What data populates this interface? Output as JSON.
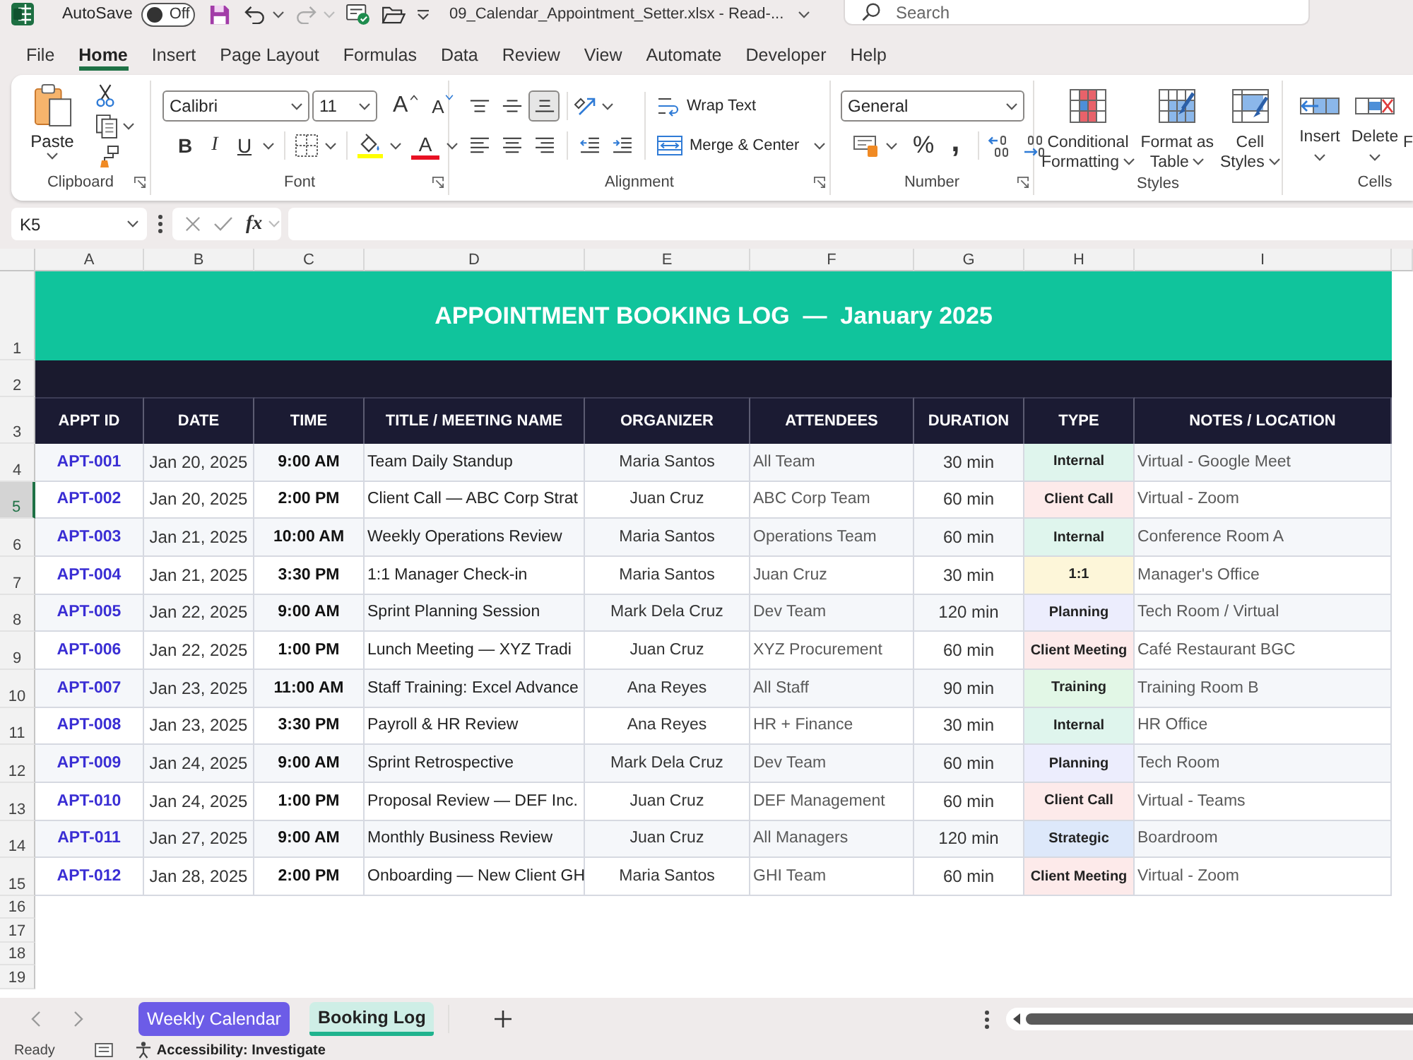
{
  "title_bar": {
    "autosave_label": "AutoSave",
    "autosave": {
      "on": false,
      "label": "Off"
    },
    "filename": "09_Calendar_Appointment_Setter.xlsx - Read-...",
    "search": {
      "placeholder": "Search"
    }
  },
  "menu_tabs": [
    {
      "label": "File",
      "selected": false
    },
    {
      "label": "Home",
      "selected": true
    },
    {
      "label": "Insert",
      "selected": false
    },
    {
      "label": "Page Layout",
      "selected": false
    },
    {
      "label": "Formulas",
      "selected": false
    },
    {
      "label": "Data",
      "selected": false
    },
    {
      "label": "Review",
      "selected": false
    },
    {
      "label": "View",
      "selected": false
    },
    {
      "label": "Automate",
      "selected": false
    },
    {
      "label": "Developer",
      "selected": false
    },
    {
      "label": "Help",
      "selected": false
    }
  ],
  "ribbon": {
    "clipboard": {
      "paste": "Paste",
      "label": "Clipboard"
    },
    "font": {
      "font_name": "Calibri",
      "font_size": "11",
      "grow": "A",
      "shrink": "A",
      "styles": [
        "B",
        "I",
        "U"
      ],
      "font_color": "A",
      "label": "Font"
    },
    "alignment": {
      "vertical_align": [
        {
          "selected": false
        },
        {
          "selected": false
        },
        {
          "selected": true
        }
      ],
      "wrap_text": "Wrap Text",
      "merge": "Merge & Center",
      "label": "Alignment"
    },
    "number": {
      "format": "General",
      "percent": "%",
      "comma": ",",
      "label": "Number"
    },
    "styles": {
      "buttons": [
        "Conditional Formatting",
        "Format as Table",
        "Cell Styles"
      ],
      "label": "Styles"
    },
    "cells": {
      "buttons": [
        "Insert",
        "Delete",
        "F"
      ],
      "label": "Cells"
    }
  },
  "formula_bar": {
    "name_box": "K5",
    "function_button": "fx"
  },
  "sheet": {
    "column_letters": [
      "A",
      "B",
      "C",
      "D",
      "E",
      "F",
      "G",
      "H",
      "I"
    ],
    "row_numbers": [
      {
        "label": "1",
        "selected": false
      },
      {
        "label": "2",
        "selected": false
      },
      {
        "label": "3",
        "selected": false
      },
      {
        "label": "4",
        "selected": false
      },
      {
        "label": "5",
        "selected": true
      },
      {
        "label": "6",
        "selected": false
      },
      {
        "label": "7",
        "selected": false
      },
      {
        "label": "8",
        "selected": false
      },
      {
        "label": "9",
        "selected": false
      },
      {
        "label": "10",
        "selected": false
      },
      {
        "label": "11",
        "selected": false
      },
      {
        "label": "12",
        "selected": false
      },
      {
        "label": "13",
        "selected": false
      },
      {
        "label": "14",
        "selected": false
      },
      {
        "label": "15",
        "selected": false
      },
      {
        "label": "16",
        "selected": false
      },
      {
        "label": "17",
        "selected": false
      },
      {
        "label": "18",
        "selected": false
      },
      {
        "label": "19",
        "selected": false
      }
    ],
    "title": "APPOINTMENT BOOKING LOG  —  January 2025",
    "headers": [
      "APPT ID",
      "DATE",
      "TIME",
      "TITLE / MEETING NAME",
      "ORGANIZER",
      "ATTENDEES",
      "DURATION",
      "TYPE",
      "NOTES / LOCATION"
    ],
    "rows": [
      {
        "id": "APT-001",
        "date": "Jan 20, 2025",
        "time": "9:00 AM",
        "title": "Team Daily Standup",
        "organizer": "Maria Santos",
        "attendees": "All Team",
        "duration": "30 min",
        "type": "Internal",
        "color": "#dff5ed",
        "notes": "Virtual - Google Meet"
      },
      {
        "id": "APT-002",
        "date": "Jan 20, 2025",
        "time": "2:00 PM",
        "title": "Client Call — ABC Corp Strat",
        "organizer": "Juan Cruz",
        "attendees": "ABC Corp Team",
        "duration": "60 min",
        "type": "Client Call",
        "color": "#fdeaea",
        "notes": "Virtual - Zoom"
      },
      {
        "id": "APT-003",
        "date": "Jan 21, 2025",
        "time": "10:00 AM",
        "title": "Weekly Operations Review",
        "organizer": "Maria Santos",
        "attendees": "Operations Team",
        "duration": "60 min",
        "type": "Internal",
        "color": "#dff5ed",
        "notes": "Conference Room A"
      },
      {
        "id": "APT-004",
        "date": "Jan 21, 2025",
        "time": "3:30 PM",
        "title": "1:1 Manager Check-in",
        "organizer": "Maria Santos",
        "attendees": "Juan Cruz",
        "duration": "30 min",
        "type": "1:1",
        "color": "#fdf6d9",
        "notes": "Manager's Office"
      },
      {
        "id": "APT-005",
        "date": "Jan 22, 2025",
        "time": "9:00 AM",
        "title": "Sprint Planning Session",
        "organizer": "Mark Dela Cruz",
        "attendees": "Dev Team",
        "duration": "120 min",
        "type": "Planning",
        "color": "#ecedfd",
        "notes": "Tech Room / Virtual"
      },
      {
        "id": "APT-006",
        "date": "Jan 22, 2025",
        "time": "1:00 PM",
        "title": "Lunch Meeting — XYZ Tradi",
        "organizer": "Juan Cruz",
        "attendees": "XYZ Procurement",
        "duration": "60 min",
        "type": "Client Meeting",
        "color": "#fdeaea",
        "notes": "Café Restaurant BGC"
      },
      {
        "id": "APT-007",
        "date": "Jan 23, 2025",
        "time": "11:00 AM",
        "title": "Staff Training: Excel Advance",
        "organizer": "Ana Reyes",
        "attendees": "All Staff",
        "duration": "90 min",
        "type": "Training",
        "color": "#e2f7e6",
        "notes": "Training Room B"
      },
      {
        "id": "APT-008",
        "date": "Jan 23, 2025",
        "time": "3:30 PM",
        "title": "Payroll & HR Review",
        "organizer": "Ana Reyes",
        "attendees": "HR + Finance",
        "duration": "30 min",
        "type": "Internal",
        "color": "#dff5ed",
        "notes": "HR Office"
      },
      {
        "id": "APT-009",
        "date": "Jan 24, 2025",
        "time": "9:00 AM",
        "title": "Sprint Retrospective",
        "organizer": "Mark Dela Cruz",
        "attendees": "Dev Team",
        "duration": "60 min",
        "type": "Planning",
        "color": "#ecedfd",
        "notes": "Tech Room"
      },
      {
        "id": "APT-010",
        "date": "Jan 24, 2025",
        "time": "1:00 PM",
        "title": "Proposal Review — DEF Inc.",
        "organizer": "Juan Cruz",
        "attendees": "DEF Management",
        "duration": "60 min",
        "type": "Client Call",
        "color": "#fdeaea",
        "notes": "Virtual - Teams"
      },
      {
        "id": "APT-011",
        "date": "Jan 27, 2025",
        "time": "9:00 AM",
        "title": "Monthly Business Review",
        "organizer": "Juan Cruz",
        "attendees": "All Managers",
        "duration": "120 min",
        "type": "Strategic",
        "color": "#dde8fa",
        "notes": "Boardroom"
      },
      {
        "id": "APT-012",
        "date": "Jan 28, 2025",
        "time": "2:00 PM",
        "title": "Onboarding — New Client GH",
        "organizer": "Maria Santos",
        "attendees": "GHI Team",
        "duration": "60 min",
        "type": "Client Meeting",
        "color": "#fdeaea",
        "notes": "Virtual - Zoom"
      }
    ]
  },
  "sheet_tabs": [
    {
      "label": "Weekly Calendar",
      "selected": false,
      "color": "#6c5ce7"
    },
    {
      "label": "Booking Log",
      "selected": true,
      "color": "#20b38e"
    }
  ],
  "status_bar": {
    "mode": "Ready",
    "accessibility": "Accessibility: Investigate"
  }
}
